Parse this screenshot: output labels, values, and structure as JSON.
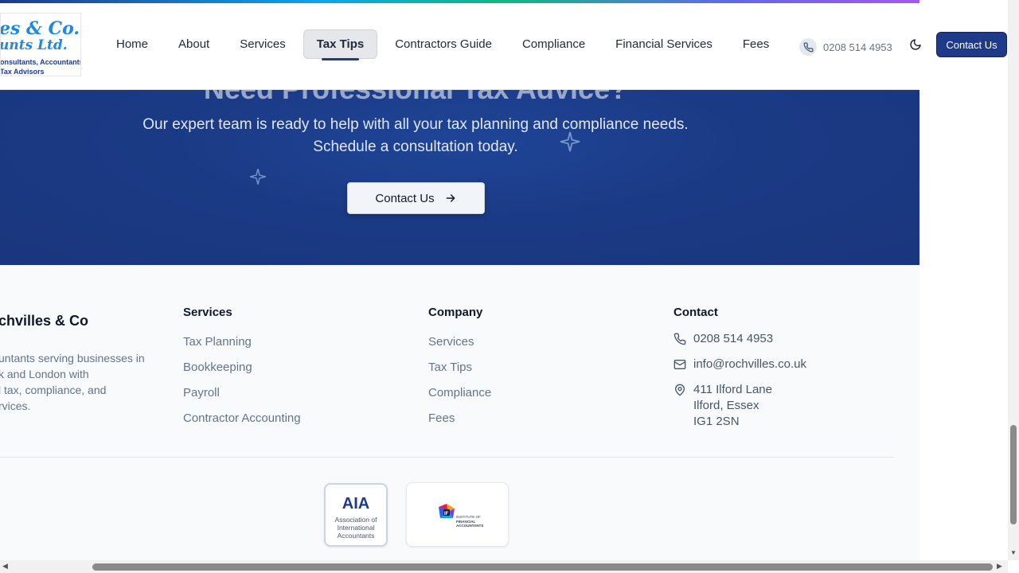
{
  "logo": {
    "line1": "es & Co.",
    "line2": "unts Ltd.",
    "line3": "onsultants, Accountants",
    "line4": "Tax Advisors"
  },
  "nav": {
    "items": [
      {
        "label": "Home",
        "active": false
      },
      {
        "label": "About",
        "active": false
      },
      {
        "label": "Services",
        "active": false
      },
      {
        "label": "Tax Tips",
        "active": true
      },
      {
        "label": "Contractors Guide",
        "active": false
      },
      {
        "label": "Compliance",
        "active": false
      },
      {
        "label": "Financial Services",
        "active": false
      },
      {
        "label": "Fees",
        "active": false
      }
    ],
    "phone": "0208 514 4953",
    "contact_button": "Contact Us"
  },
  "cta": {
    "heading": "Need Professional Tax Advice?",
    "text_line1": "Our expert team is ready to help with all your tax planning and compliance needs.",
    "text_line2": "Schedule a consultation today.",
    "button": "Contact Us"
  },
  "footer": {
    "brand_name": "chvilles & Co",
    "brand_desc_lines": [
      "untants serving businesses in",
      "k and London with",
      "l tax, compliance, and",
      "rvices."
    ],
    "services": {
      "heading": "Services",
      "links": [
        "Tax Planning",
        "Bookkeeping",
        "Payroll",
        "Contractor Accounting"
      ]
    },
    "company": {
      "heading": "Company",
      "links": [
        "Services",
        "Tax Tips",
        "Compliance",
        "Fees"
      ]
    },
    "contact": {
      "heading": "Contact",
      "phone": "0208 514 4953",
      "email": "info@rochvilles.co.uk",
      "address_lines": [
        "411 Ilford Lane",
        "Ilford, Essex",
        "IG1 2SN"
      ]
    },
    "badges": {
      "aia_title": "AIA",
      "aia_sub_lines": [
        "Association of",
        "International",
        "Accountants"
      ],
      "ifa_lines": [
        "INSTITUTE OF",
        "FINANCIAL",
        "ACCOUNTANTS"
      ]
    }
  },
  "colors": {
    "brand_navy": "#1e3a8a",
    "cta_bg": "#1b3a85",
    "logo_blue": "#1e88e5"
  }
}
